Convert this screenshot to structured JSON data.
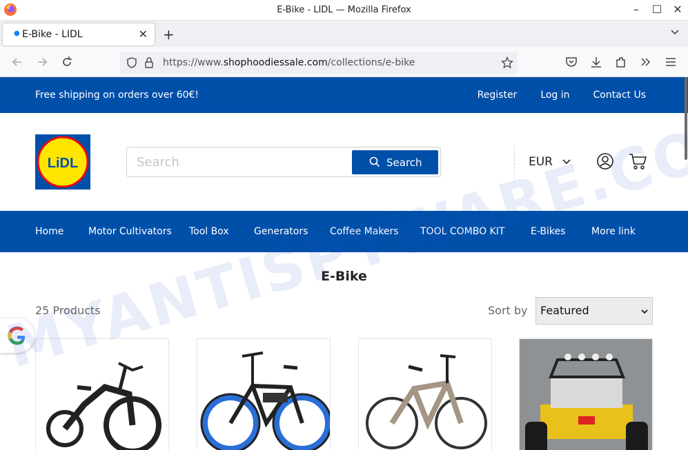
{
  "browser": {
    "window_title": "E-Bike - LIDL — Mozilla Firefox",
    "tab_title": "E-Bike - LIDL",
    "url_prefix": "https://www.",
    "url_host": "shophoodiessale.com",
    "url_path": "/collections/e-bike"
  },
  "topbar": {
    "message": "Free shipping on orders over 60€!",
    "register": "Register",
    "login": "Log in",
    "contact": "Contact Us"
  },
  "header": {
    "search_placeholder": "Search",
    "search_button": "Search",
    "currency": "EUR"
  },
  "nav": [
    "Home",
    "Motor Cultivators",
    "Tool Box",
    "Generators",
    "Coffee Makers",
    "TOOL COMBO KIT",
    "E-Bikes",
    "More link"
  ],
  "collection": {
    "title": "E-Bike",
    "count": "25 Products",
    "sort_label": "Sort by",
    "sort_value": "Featured"
  },
  "watermark": "MYANTISPYWARE.COM",
  "colors": {
    "brand_blue": "#0050aa",
    "lidl_yellow": "#ffe500",
    "lidl_red": "#e60a14"
  }
}
